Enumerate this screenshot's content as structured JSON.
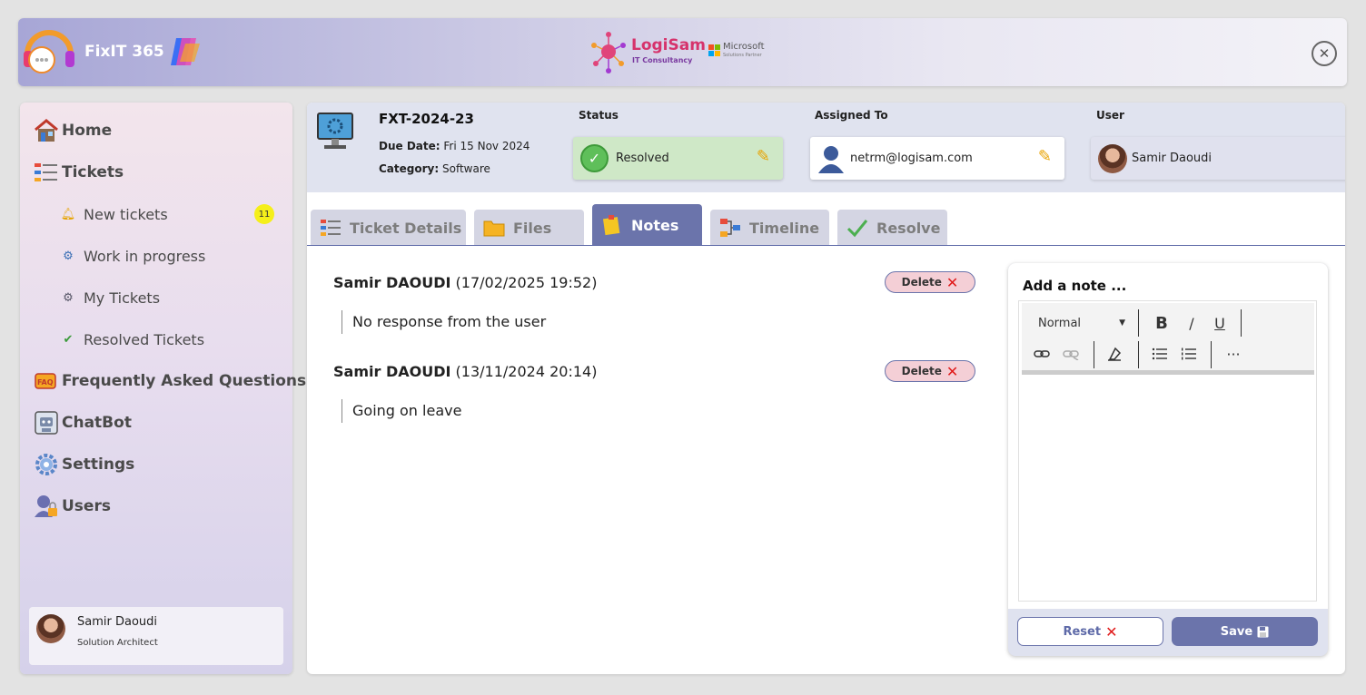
{
  "header": {
    "app_name": "FixIT 365",
    "partner_name": "LogiSam",
    "partner_sub": "IT Consultancy",
    "ms_name": "Microsoft",
    "ms_sub": "Solutions Partner",
    "close_symbol": "✕"
  },
  "sidebar": {
    "home": "Home",
    "tickets": "Tickets",
    "new_tickets": "New tickets",
    "new_tickets_count": "11",
    "work_in_progress": "Work in progress",
    "my_tickets": "My Tickets",
    "resolved_tickets": "Resolved Tickets",
    "faq": "Frequently Asked Questions",
    "faq_icon_text": "FAQ",
    "chatbot": "ChatBot",
    "settings": "Settings",
    "users": "Users",
    "profile": {
      "name": "Samir Daoudi",
      "role": "Solution Architect"
    }
  },
  "ticket": {
    "id": "FXT-2024-23",
    "due_label": "Due Date:",
    "due_value": "Fri 15 Nov 2024",
    "category_label": "Category:",
    "category_value": "Software",
    "status_label": "Status",
    "status_value": "Resolved",
    "assigned_label": "Assigned To",
    "assigned_value": "netrm@logisam.com",
    "user_label": "User",
    "user_value": "Samir Daoudi"
  },
  "tabs": {
    "details": "Ticket Details",
    "files": "Files",
    "notes": "Notes",
    "timeline": "Timeline",
    "resolve": "Resolve",
    "active": "notes"
  },
  "notes": [
    {
      "author": "Samir DAOUDI",
      "timestamp": "(17/02/2025 19:52)",
      "text": "No response from the user",
      "delete_label": "Delete"
    },
    {
      "author": "Samir DAOUDI",
      "timestamp": "(13/11/2024 20:14)",
      "text": "Going on leave",
      "delete_label": "Delete"
    }
  ],
  "note_editor": {
    "title": "Add a note ...",
    "format_value": "Normal",
    "bold": "B",
    "italic": "/",
    "underline": "U",
    "more": "···",
    "reset_label": "Reset",
    "save_label": "Save"
  },
  "colors": {
    "accent": "#6b74ab",
    "status_bg": "#cfe8c7",
    "badge": "#f5ef1a",
    "delete_bg": "#f4cfd6",
    "delete_x": "#e01b1b"
  }
}
